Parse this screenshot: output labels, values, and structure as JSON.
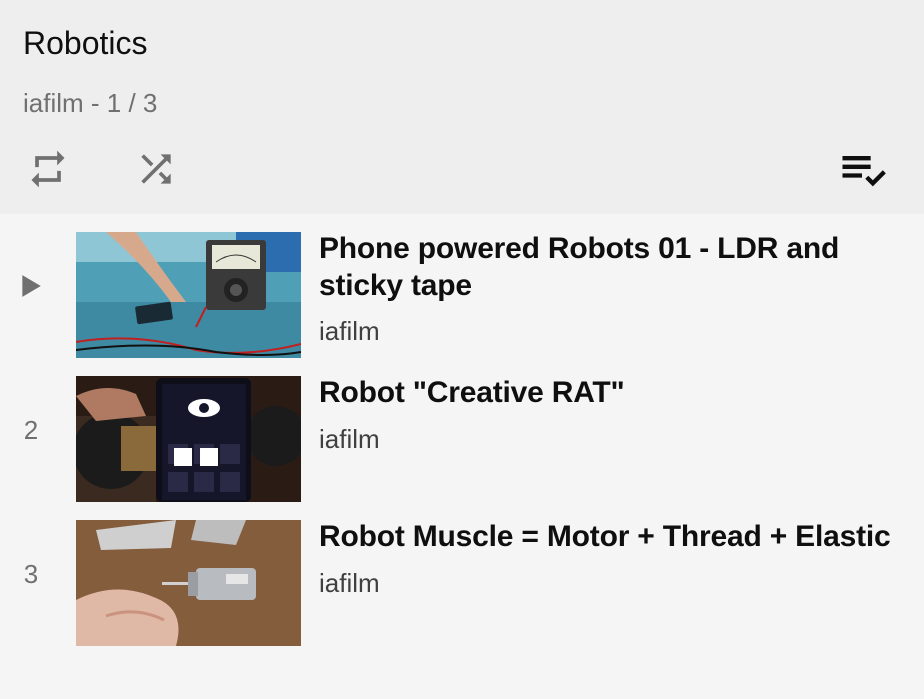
{
  "playlist": {
    "title": "Robotics",
    "subtitle": "iafilm - 1 / 3"
  },
  "controls": {
    "loop_icon": "loop-icon",
    "shuffle_icon": "shuffle-icon",
    "save_icon": "playlist-save-icon"
  },
  "videos": [
    {
      "index": "",
      "now_playing": true,
      "title": "Phone powered Robots 01 - LDR and sticky tape",
      "channel": "iafilm"
    },
    {
      "index": "2",
      "now_playing": false,
      "title": "Robot \"Creative RAT\"",
      "channel": "iafilm"
    },
    {
      "index": "3",
      "now_playing": false,
      "title": "Robot Muscle = Motor + Thread + Elastic",
      "channel": "iafilm"
    }
  ]
}
